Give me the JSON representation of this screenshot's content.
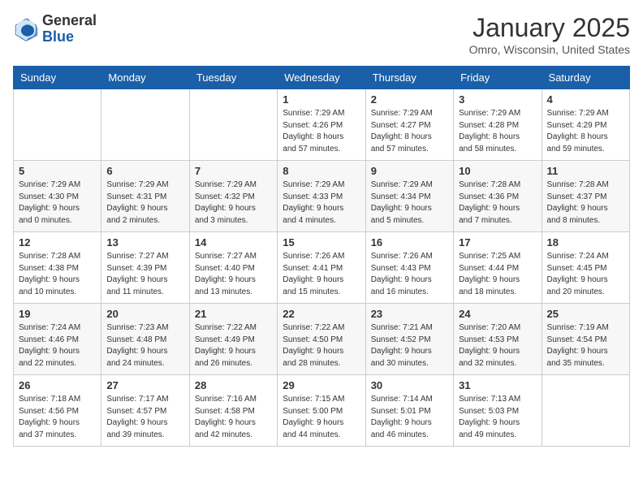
{
  "header": {
    "logo_line1": "General",
    "logo_line2": "Blue",
    "month": "January 2025",
    "location": "Omro, Wisconsin, United States"
  },
  "weekdays": [
    "Sunday",
    "Monday",
    "Tuesday",
    "Wednesday",
    "Thursday",
    "Friday",
    "Saturday"
  ],
  "weeks": [
    [
      {
        "day": "",
        "info": ""
      },
      {
        "day": "",
        "info": ""
      },
      {
        "day": "",
        "info": ""
      },
      {
        "day": "1",
        "info": "Sunrise: 7:29 AM\nSunset: 4:26 PM\nDaylight: 8 hours\nand 57 minutes."
      },
      {
        "day": "2",
        "info": "Sunrise: 7:29 AM\nSunset: 4:27 PM\nDaylight: 8 hours\nand 57 minutes."
      },
      {
        "day": "3",
        "info": "Sunrise: 7:29 AM\nSunset: 4:28 PM\nDaylight: 8 hours\nand 58 minutes."
      },
      {
        "day": "4",
        "info": "Sunrise: 7:29 AM\nSunset: 4:29 PM\nDaylight: 8 hours\nand 59 minutes."
      }
    ],
    [
      {
        "day": "5",
        "info": "Sunrise: 7:29 AM\nSunset: 4:30 PM\nDaylight: 9 hours\nand 0 minutes."
      },
      {
        "day": "6",
        "info": "Sunrise: 7:29 AM\nSunset: 4:31 PM\nDaylight: 9 hours\nand 2 minutes."
      },
      {
        "day": "7",
        "info": "Sunrise: 7:29 AM\nSunset: 4:32 PM\nDaylight: 9 hours\nand 3 minutes."
      },
      {
        "day": "8",
        "info": "Sunrise: 7:29 AM\nSunset: 4:33 PM\nDaylight: 9 hours\nand 4 minutes."
      },
      {
        "day": "9",
        "info": "Sunrise: 7:29 AM\nSunset: 4:34 PM\nDaylight: 9 hours\nand 5 minutes."
      },
      {
        "day": "10",
        "info": "Sunrise: 7:28 AM\nSunset: 4:36 PM\nDaylight: 9 hours\nand 7 minutes."
      },
      {
        "day": "11",
        "info": "Sunrise: 7:28 AM\nSunset: 4:37 PM\nDaylight: 9 hours\nand 8 minutes."
      }
    ],
    [
      {
        "day": "12",
        "info": "Sunrise: 7:28 AM\nSunset: 4:38 PM\nDaylight: 9 hours\nand 10 minutes."
      },
      {
        "day": "13",
        "info": "Sunrise: 7:27 AM\nSunset: 4:39 PM\nDaylight: 9 hours\nand 11 minutes."
      },
      {
        "day": "14",
        "info": "Sunrise: 7:27 AM\nSunset: 4:40 PM\nDaylight: 9 hours\nand 13 minutes."
      },
      {
        "day": "15",
        "info": "Sunrise: 7:26 AM\nSunset: 4:41 PM\nDaylight: 9 hours\nand 15 minutes."
      },
      {
        "day": "16",
        "info": "Sunrise: 7:26 AM\nSunset: 4:43 PM\nDaylight: 9 hours\nand 16 minutes."
      },
      {
        "day": "17",
        "info": "Sunrise: 7:25 AM\nSunset: 4:44 PM\nDaylight: 9 hours\nand 18 minutes."
      },
      {
        "day": "18",
        "info": "Sunrise: 7:24 AM\nSunset: 4:45 PM\nDaylight: 9 hours\nand 20 minutes."
      }
    ],
    [
      {
        "day": "19",
        "info": "Sunrise: 7:24 AM\nSunset: 4:46 PM\nDaylight: 9 hours\nand 22 minutes."
      },
      {
        "day": "20",
        "info": "Sunrise: 7:23 AM\nSunset: 4:48 PM\nDaylight: 9 hours\nand 24 minutes."
      },
      {
        "day": "21",
        "info": "Sunrise: 7:22 AM\nSunset: 4:49 PM\nDaylight: 9 hours\nand 26 minutes."
      },
      {
        "day": "22",
        "info": "Sunrise: 7:22 AM\nSunset: 4:50 PM\nDaylight: 9 hours\nand 28 minutes."
      },
      {
        "day": "23",
        "info": "Sunrise: 7:21 AM\nSunset: 4:52 PM\nDaylight: 9 hours\nand 30 minutes."
      },
      {
        "day": "24",
        "info": "Sunrise: 7:20 AM\nSunset: 4:53 PM\nDaylight: 9 hours\nand 32 minutes."
      },
      {
        "day": "25",
        "info": "Sunrise: 7:19 AM\nSunset: 4:54 PM\nDaylight: 9 hours\nand 35 minutes."
      }
    ],
    [
      {
        "day": "26",
        "info": "Sunrise: 7:18 AM\nSunset: 4:56 PM\nDaylight: 9 hours\nand 37 minutes."
      },
      {
        "day": "27",
        "info": "Sunrise: 7:17 AM\nSunset: 4:57 PM\nDaylight: 9 hours\nand 39 minutes."
      },
      {
        "day": "28",
        "info": "Sunrise: 7:16 AM\nSunset: 4:58 PM\nDaylight: 9 hours\nand 42 minutes."
      },
      {
        "day": "29",
        "info": "Sunrise: 7:15 AM\nSunset: 5:00 PM\nDaylight: 9 hours\nand 44 minutes."
      },
      {
        "day": "30",
        "info": "Sunrise: 7:14 AM\nSunset: 5:01 PM\nDaylight: 9 hours\nand 46 minutes."
      },
      {
        "day": "31",
        "info": "Sunrise: 7:13 AM\nSunset: 5:03 PM\nDaylight: 9 hours\nand 49 minutes."
      },
      {
        "day": "",
        "info": ""
      }
    ]
  ]
}
